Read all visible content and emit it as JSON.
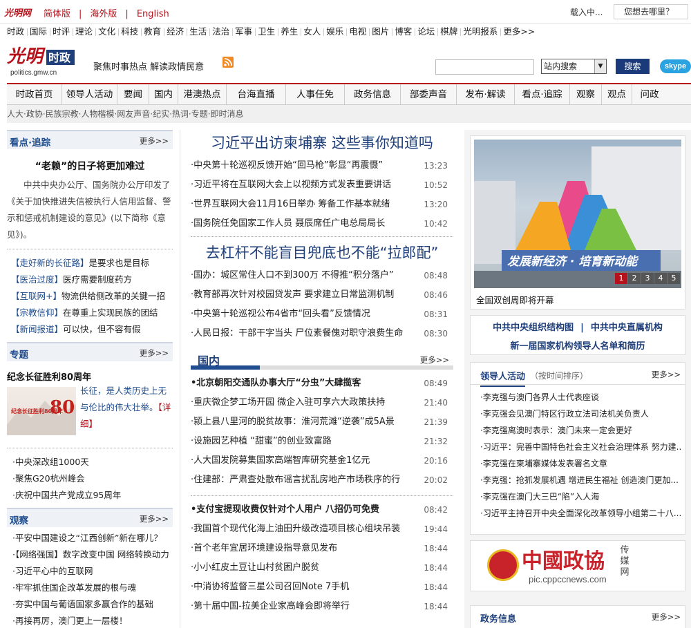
{
  "topbar": {
    "logo_text": "光明网",
    "langs": [
      "简体版",
      "海外版",
      "English"
    ],
    "loading": "载入中...",
    "where_placeholder": "您想去哪里？"
  },
  "channels": [
    "时政",
    "国际",
    "时评",
    "理论",
    "文化",
    "科技",
    "教育",
    "经济",
    "生活",
    "法治",
    "军事",
    "卫生",
    "养生",
    "女人",
    "娱乐",
    "电视",
    "图片",
    "博客",
    "论坛",
    "棋牌",
    "光明报系",
    "更多>>"
  ],
  "header": {
    "logo_text": "光明",
    "logo_sub": "时政",
    "domain": "politics.gmw.cn",
    "slogan": "聚焦时事热点 解读政情民意",
    "search_select": "站内搜索",
    "search_button": "搜索",
    "skype": "skype"
  },
  "mainnav": [
    "时政首页",
    "领导人活动",
    "要闻",
    "国内",
    "港澳热点",
    "台海直播",
    "人事任免",
    "政务信息",
    "部委声音",
    "发布·解读",
    "看点·追踪",
    "观察",
    "观点",
    "问政"
  ],
  "subnav": "人大·政协·民族宗教·人物楷模·网友声音·纪实·热词·专题·即时消息",
  "left": {
    "box1": {
      "title": "看点·追踪",
      "more": "更多>>",
      "lead_title": "“老赖”的日子将更加难过",
      "lead_body": "中共中央办公厅、国务院办公厅印发了《关于加快推进失信被执行人信用监督、警示和惩戒机制建设的意见》(以下简称《意见》)。",
      "items": [
        {
          "tag": "【走好新的长征路】",
          "text": "是要求也是目标"
        },
        {
          "tag": "【医治过度】",
          "text": "医疗需要制度药方"
        },
        {
          "tag": "【互联网+】",
          "text": "物流供给侧改革的关键一招"
        },
        {
          "tag": "【宗教信仰】",
          "text": "在尊重上实现民族的团结"
        },
        {
          "tag": "【新闻报道】",
          "text": "可以快，但不容有假"
        }
      ]
    },
    "box2": {
      "title": "专题",
      "more": "更多>>",
      "feature_title": "纪念长征胜利80周年",
      "feature_text": "长征，是人类历史上无与伦比的伟大壮举。",
      "feature_link": "【详细】",
      "feature_img_text": "纪念长征胜利80周年",
      "items": [
        "·中央深改组1000天",
        "·聚焦G20杭州峰会",
        "·庆祝中国共产党成立95周年"
      ]
    },
    "box3": {
      "title": "观察",
      "more": "更多>>",
      "items": [
        "·平安中国建设之“江西创新”新在哪儿？",
        "·【网络强国】数字改变中国 网络转换动力",
        "·习近平心中的互联网",
        "·牢牢抓住国企改革发展的根与魂",
        "·夯实中国与葡语国家多赢合作的基础",
        "·再接再厉，澳门更上一层楼！"
      ]
    }
  },
  "center": {
    "headline1": "习近平出访柬埔寨 这些事你知道吗",
    "group1": [
      {
        "text": "·中央第十轮巡视反馈开始“回马枪”彰显“再震慑”",
        "time": "13:23"
      },
      {
        "text": "·习近平将在互联网大会上以视频方式发表重要讲话",
        "time": "10:52"
      },
      {
        "text": "·世界互联网大会11月16日举办 筹备工作基本就绪",
        "time": "13:20"
      },
      {
        "text": "·国务院任免国家工作人员 聂辰席任广电总局局长",
        "time": "10:42"
      }
    ],
    "headline2": "去杠杆不能盲目兜底也不能“拉郎配”",
    "group2": [
      {
        "text": "·国办：城区常住人口不到300万 不得推“积分落户”",
        "time": "08:48"
      },
      {
        "text": "·教育部再次针对校园贷发声 要求建立日常监测机制",
        "time": "08:46"
      },
      {
        "text": "·中央第十轮巡视公布4省市“回头看”反馈情况",
        "time": "08:31"
      },
      {
        "text": "·人民日报：干部干字当头 尸位素餐傀对职守浪费生命",
        "time": "08:30"
      }
    ],
    "section": {
      "title": "国内",
      "more": "更多>>"
    },
    "group3": [
      {
        "text": "•北京朝阳交通队办事大厅“分虫”大肆揽客",
        "time": "08:49",
        "bold": true
      },
      {
        "text": "·重庆微企梦工场开园 微企入驻可享六大政策扶持",
        "time": "21:40"
      },
      {
        "text": "·颍上县八里河的脱贫故事：淮河荒滩“逆袭”成5A景",
        "time": "21:39"
      },
      {
        "text": "·设施园艺种植 “甜蜜”的创业致富路",
        "time": "21:32"
      },
      {
        "text": "·人大国发院募集国家高端智库研究基金1亿元",
        "time": "20:16"
      },
      {
        "text": "·住建部：严肃查处散布谣言扰乱房地产市场秩序的行",
        "time": "20:02"
      }
    ],
    "group4": [
      {
        "text": "•支付宝提现收费仅针对个人用户 八招仍可免费",
        "time": "08:42",
        "bold": true
      },
      {
        "text": "·我国首个现代化海上油田升级改造项目核心组块吊装",
        "time": "19:44"
      },
      {
        "text": "·首个老年宜居环境建设指导意见发布",
        "time": "18:44"
      },
      {
        "text": "·小小红皮土豆让山村贫困户脱贫",
        "time": "18:44"
      },
      {
        "text": "·中消协将监督三星公司召回Note 7手机",
        "time": "18:44"
      },
      {
        "text": "·第十届中国-拉美企业家高峰会即将举行",
        "time": "18:44"
      }
    ]
  },
  "right": {
    "photo_text": "发展新经济 · 培育新动能",
    "photo_caption": "全国双创周即将开幕",
    "pager": [
      "1",
      "2",
      "3",
      "4",
      "5"
    ],
    "links": {
      "line1_a": "中共中央组织结构图",
      "line1_sep": "|",
      "line1_b": "中共中央直属机构",
      "line2": "新一届国家机构领导人名单和简历"
    },
    "leaders": {
      "title": "领导人活动",
      "subtitle": "（按时间排序）",
      "more": "更多>>",
      "items": [
        "·李克强与澳门各界人士代表座谈",
        "·李克强会见澳门特区行政立法司法机关负责人",
        "·李克强离澳时表示：澳门未来一定会更好",
        "·习近平：完善中国特色社会主义社会治理体系 努力建...",
        "·李克强在柬埔寨媒体发表署名文章",
        "·李克强：抢抓发展机遇 增进民生福祉 创造澳门更加...",
        "·李克强在澳门大三巴“陷”入人海",
        "·习近平主持召开中央全面深化改革领导小组第二十八..."
      ]
    },
    "banner": {
      "title": "中國政協",
      "tag1": "传",
      "tag2": "媒",
      "tag3": "网",
      "url": "pic.cppccnews.com"
    },
    "gov": {
      "title": "政务信息",
      "more": "更多>>"
    }
  },
  "colors": {
    "accent_red": "#b5121b",
    "accent_blue": "#1f4d8f",
    "headline_blue": "#1f3f7a"
  }
}
